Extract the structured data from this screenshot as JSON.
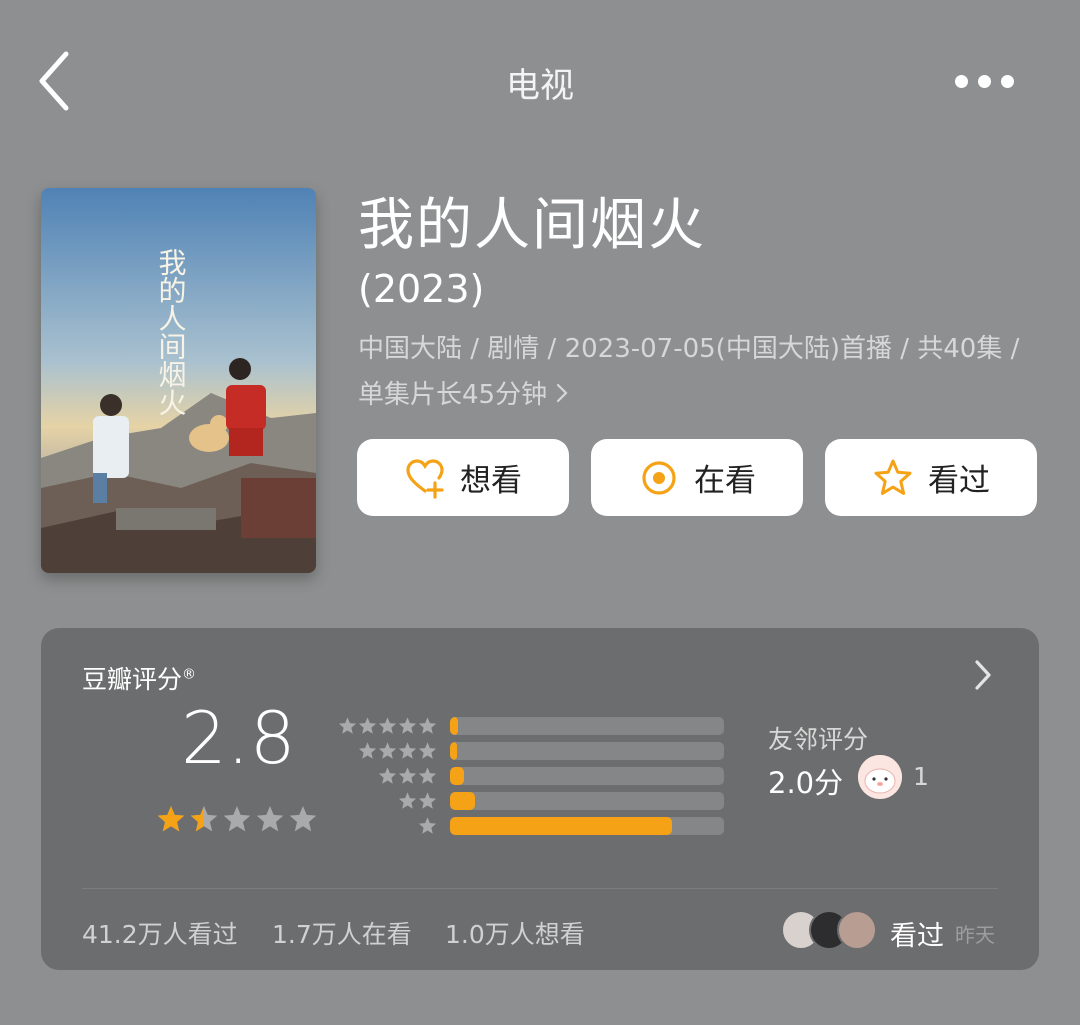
{
  "header": {
    "title": "电视"
  },
  "show": {
    "title": "我的人间烟火",
    "year": "(2023)",
    "meta": "中国大陆 / 剧情 / 2023-07-05(中国大陆)首播 / 共40集 / 单集片长45分钟",
    "poster_text": "我的人间烟火"
  },
  "actions": [
    {
      "label": "想看",
      "icon": "heart-plus-icon"
    },
    {
      "label": "在看",
      "icon": "target-icon"
    },
    {
      "label": "看过",
      "icon": "star-outline-icon"
    }
  ],
  "rating": {
    "label": "豆瓣评分",
    "mark": "®",
    "score": "2.8",
    "stars_value": 1.5,
    "stars_max": 5,
    "distribution": [
      {
        "stars": 5,
        "fraction": 0.03
      },
      {
        "stars": 4,
        "fraction": 0.02
      },
      {
        "stars": 3,
        "fraction": 0.05
      },
      {
        "stars": 2,
        "fraction": 0.09
      },
      {
        "stars": 1,
        "fraction": 0.81
      }
    ],
    "friends_label": "友邻评分",
    "friends_score": "2.0分",
    "friends_count": "1"
  },
  "stats": {
    "watched": "41.2万人看过",
    "watching": "1.7万人在看",
    "want": "1.0万人想看",
    "activity": "看过",
    "activity_time": "昨天"
  },
  "colors": {
    "accent": "#f5a216",
    "background": "#8d8f90",
    "card": "#6c6d6e",
    "track": "#858687"
  }
}
